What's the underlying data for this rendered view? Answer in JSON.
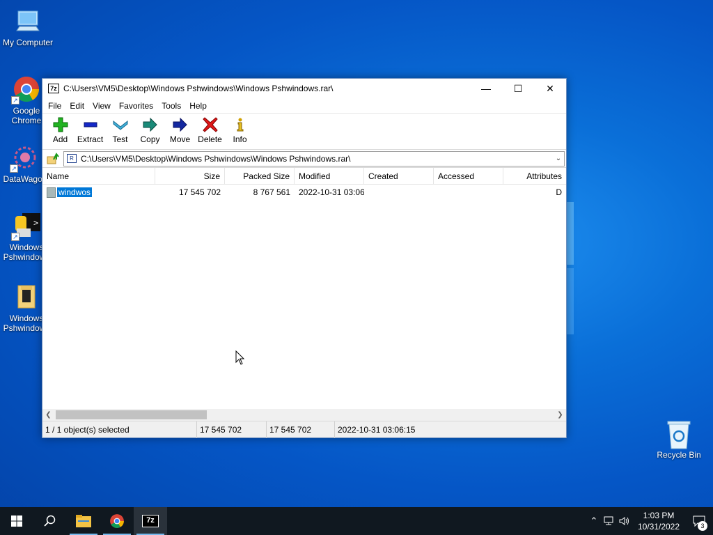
{
  "desktop": {
    "icons": [
      {
        "label": "My Computer"
      },
      {
        "label": "Google Chrome"
      },
      {
        "label": "DataWagon"
      },
      {
        "label": "Windows Pshwindows"
      },
      {
        "label": "Windows Pshwindows"
      },
      {
        "label": "Recycle Bin"
      }
    ]
  },
  "window": {
    "app_icon_text": "7z",
    "title": "C:\\Users\\VM5\\Desktop\\Windows Pshwindows\\Windows Pshwindows.rar\\",
    "minimize": "—",
    "maximize": "☐",
    "close": "✕",
    "menu": [
      "File",
      "Edit",
      "View",
      "Favorites",
      "Tools",
      "Help"
    ],
    "toolbar": [
      "Add",
      "Extract",
      "Test",
      "Copy",
      "Move",
      "Delete",
      "Info"
    ],
    "address": "C:\\Users\\VM5\\Desktop\\Windows Pshwindows\\Windows Pshwindows.rar\\",
    "address_icon_text": "R",
    "columns": [
      "Name",
      "Size",
      "Packed Size",
      "Modified",
      "Created",
      "Accessed",
      "Attributes"
    ],
    "rows": [
      {
        "name": "windwos",
        "size": "17 545 702",
        "packed": "8 767 561",
        "modified": "2022-10-31 03:06",
        "created": "",
        "accessed": "",
        "attributes": "D"
      }
    ],
    "status": {
      "selected": "1 / 1 object(s) selected",
      "size": "17 545 702",
      "packed": "17 545 702",
      "modified": "2022-10-31 03:06:15"
    }
  },
  "taskbar": {
    "app_7z": "7z",
    "time": "1:03 PM",
    "date": "10/31/2022",
    "notification_count": "3"
  },
  "colors": {
    "selection": "#0078d7",
    "add_icon": "#22b322",
    "extract_icon": "#1428c8",
    "test_icon": "#40b0d8",
    "copy_icon": "#1a8a78",
    "move_icon": "#1428a0",
    "delete_icon": "#e01818"
  }
}
